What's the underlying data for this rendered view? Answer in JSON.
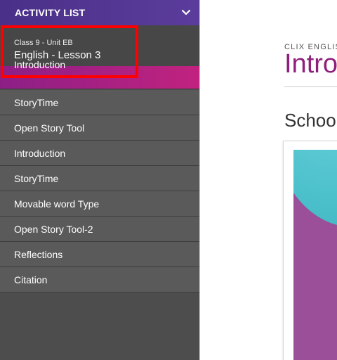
{
  "sidebar": {
    "header_title": "ACTIVITY LIST",
    "lesson_unit": "Class 9 - Unit EB",
    "lesson_name": "English - Lesson 3",
    "items": [
      {
        "label": "Introduction",
        "active": true
      },
      {
        "label": "StoryTime"
      },
      {
        "label": "Open Story Tool"
      },
      {
        "label": "Introduction"
      },
      {
        "label": "StoryTime"
      },
      {
        "label": "Movable word Type"
      },
      {
        "label": "Open Story Tool-2"
      },
      {
        "label": "Reflections"
      },
      {
        "label": "Citation"
      }
    ]
  },
  "main": {
    "eyebrow": "CLIX ENGLISH",
    "heading": "Intro",
    "section_title": "Schoo"
  },
  "colors": {
    "header_purple": "#4a3088",
    "active_magenta": "#c2227f",
    "heading_magenta": "#8f1f7c",
    "highlight_red": "#ff0000",
    "sidebar_gray": "#5a5a5a"
  },
  "icons": {
    "header_toggle": "chevron-down-icon"
  }
}
